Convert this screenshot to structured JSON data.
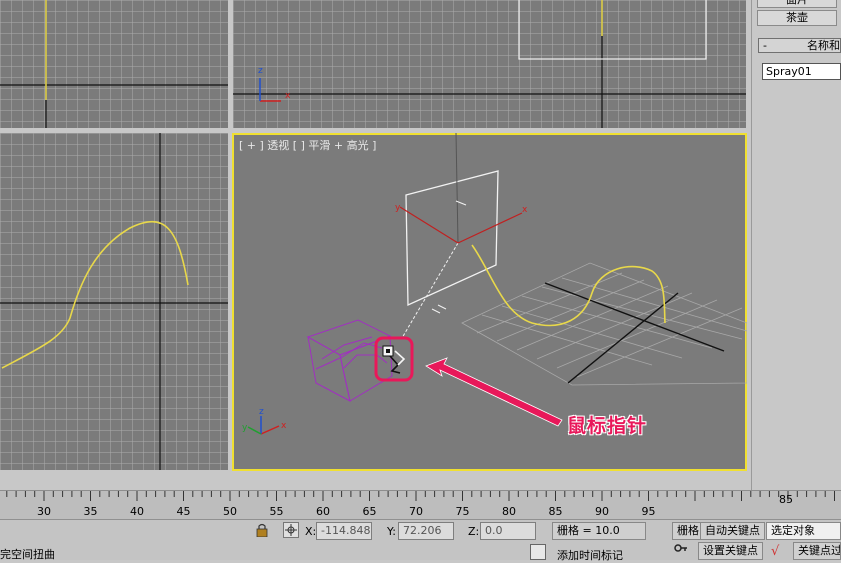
{
  "command_panel": {
    "button_top": "面片",
    "button_teapot": "茶壶",
    "rollout_name": "名称和",
    "rollout_toggle": "-",
    "object_name": "Spray01"
  },
  "viewports": {
    "perspective_label": "[ + ] 透视 [ ] 平滑 + 高光 ]",
    "axis_x": "x",
    "axis_y": "y",
    "axis_z": "z"
  },
  "annotation": {
    "text": "鼠标指针"
  },
  "timeline": {
    "ticks": [
      "30",
      "35",
      "40",
      "45",
      "50",
      "55",
      "60",
      "65",
      "70",
      "75",
      "80",
      "85",
      "90",
      "95"
    ],
    "last_tick": "85"
  },
  "status_bar": {
    "left_text": "完空间扭曲",
    "x_label": "X:",
    "x_value": "-114.848",
    "y_label": "Y:",
    "y_value": "72.206",
    "z_label": "Z:",
    "z_value": "0.0",
    "grid_text": "栅格 = 10.0",
    "grid_btn": "栅格",
    "auto_key": "自动关键点",
    "selected_object": "选定对象",
    "add_time_tag": "添加时间标记",
    "set_key": "设置关键点",
    "key_filter": "关键点过"
  },
  "colors": {
    "active_viewport_border": "#f0e030",
    "curve": "#e8d84a",
    "annotation": "#e8185a",
    "cube": "#a030c0"
  }
}
